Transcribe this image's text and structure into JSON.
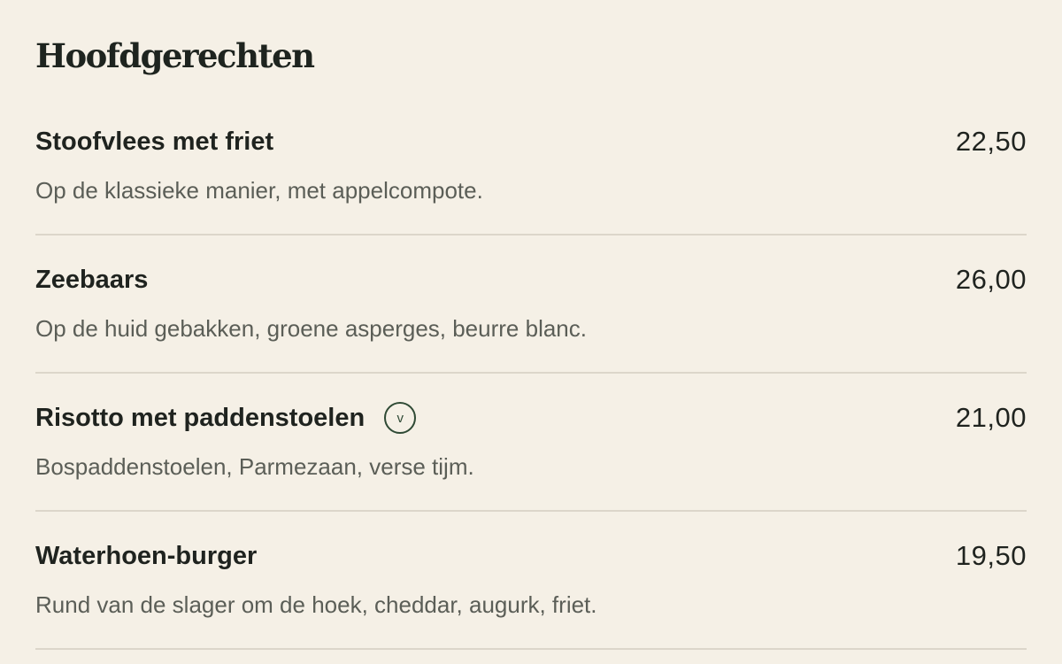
{
  "section": {
    "title": "Hoofdgerechten"
  },
  "items": [
    {
      "name": "Stoofvlees met friet",
      "price": "22,50",
      "description": "Op de klassieke manier, met appelcompote.",
      "vegetarian": false
    },
    {
      "name": "Zeebaars",
      "price": "26,00",
      "description": "Op de huid gebakken, groene asperges, beurre blanc.",
      "vegetarian": false
    },
    {
      "name": "Risotto met paddenstoelen",
      "price": "21,00",
      "description": "Bospaddenstoelen, Parmezaan, verse tijm.",
      "vegetarian": true,
      "badge": "v"
    },
    {
      "name": "Waterhoen-burger",
      "price": "19,50",
      "description": "Rund van de slager om de hoek, cheddar, augurk, friet.",
      "vegetarian": false
    }
  ],
  "colors": {
    "background": "#f5f0e6",
    "text": "#1f231f",
    "muted": "#5b5e57",
    "divider": "#dcd6ca",
    "accent": "#2f4a35"
  }
}
